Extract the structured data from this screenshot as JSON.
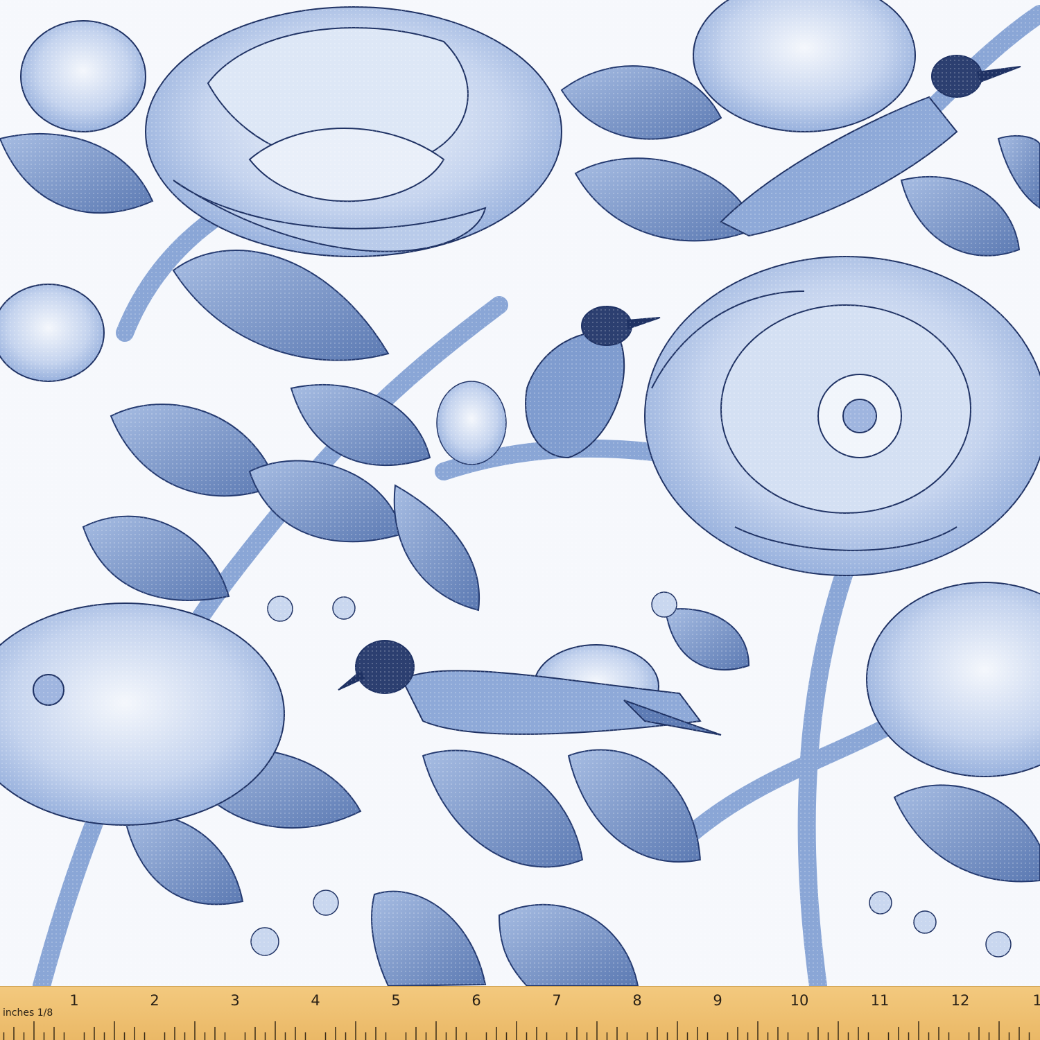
{
  "image": {
    "subject": "blue toile floral fabric swatch",
    "colors": {
      "background": "#f7f9fc",
      "petal_light": "#dbe5f5",
      "petal_mid": "#a9bfe4",
      "leaf": "#8aa6d6",
      "leaf_dark": "#5d7bb4",
      "ink": "#1f3264",
      "ruler": "#eab866"
    }
  },
  "ruler": {
    "unit_label": "inches 1/8",
    "numbers": [
      "1",
      "2",
      "3",
      "4",
      "5",
      "6",
      "7",
      "8",
      "9",
      "10",
      "11",
      "12",
      "1"
    ]
  }
}
